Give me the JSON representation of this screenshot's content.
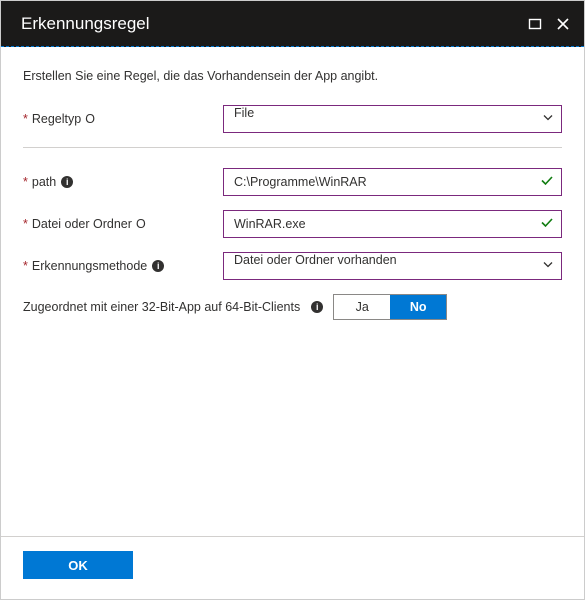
{
  "header": {
    "title": "Erkennungsregel"
  },
  "intro": "Erstellen Sie eine Regel, die das Vorhandensein der App angibt.",
  "fields": {
    "ruleType": {
      "label": "Regeltyp",
      "value": "File"
    },
    "path": {
      "label": "path",
      "value": "C:\\Programme\\WinRAR"
    },
    "fileOrFolder": {
      "label": "Datei oder Ordner",
      "value": "WinRAR.exe"
    },
    "detectionMethod": {
      "label": "Erkennungsmethode",
      "value": "Datei oder Ordner vorhanden"
    }
  },
  "toggle": {
    "label": "Zugeordnet mit einer 32-Bit-App auf 64-Bit-Clients",
    "yes": "Ja",
    "no": "No",
    "selected": "no"
  },
  "footer": {
    "ok": "OK"
  }
}
